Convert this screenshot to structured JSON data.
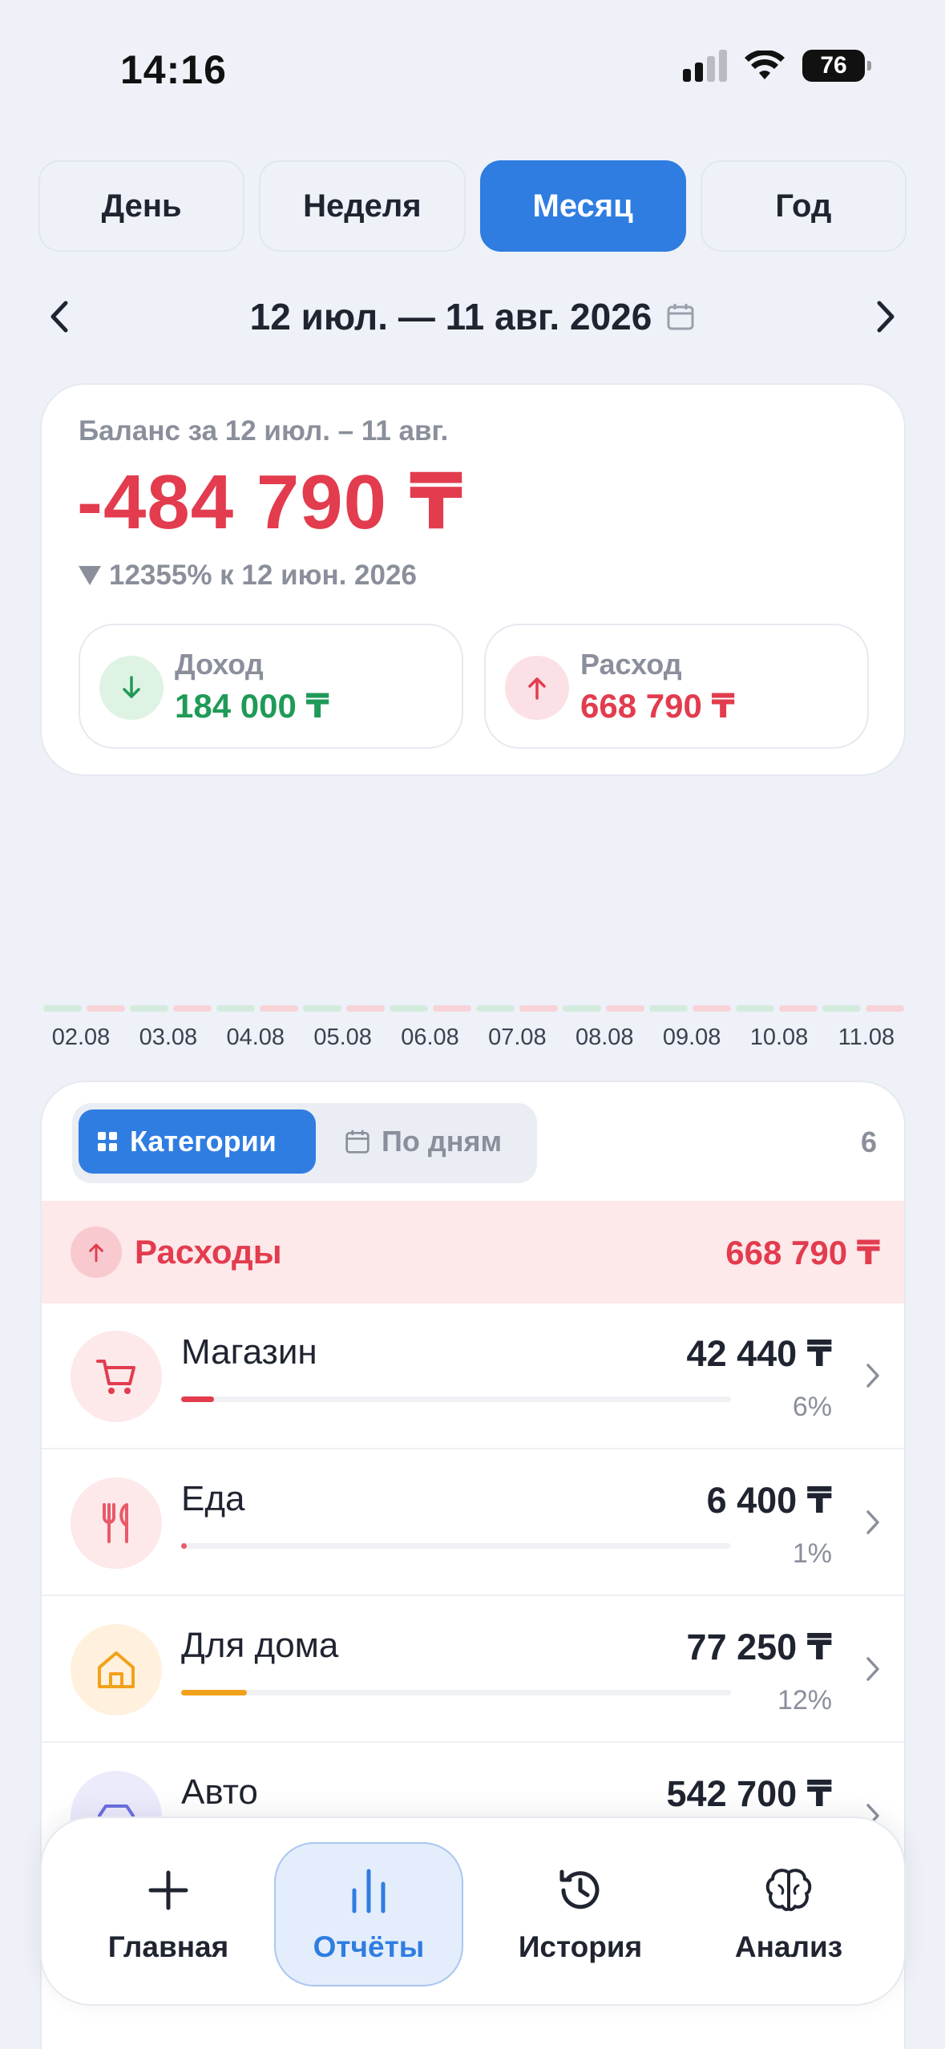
{
  "status_bar": {
    "time": "14:16",
    "battery": "76"
  },
  "period_tabs": [
    {
      "label": "День",
      "active": false
    },
    {
      "label": "Неделя",
      "active": false
    },
    {
      "label": "Месяц",
      "active": true
    },
    {
      "label": "Год",
      "active": false
    }
  ],
  "date_range": {
    "label": "12 июл. — 11 авг. 2026"
  },
  "balance": {
    "caption": "Баланс за 12 июл. – 11 авг.",
    "value": "-484 790 ₸",
    "delta": "12355% к 12 июн. 2026",
    "income": {
      "label": "Доход",
      "value": "184 000 ₸"
    },
    "expense": {
      "label": "Расход",
      "value": "668 790 ₸"
    }
  },
  "timeline": {
    "dates": [
      "02.08",
      "03.08",
      "04.08",
      "05.08",
      "06.08",
      "07.08",
      "08.08",
      "09.08",
      "10.08",
      "11.08"
    ],
    "colors": {
      "income": "#d3ebdd",
      "expense": "#f7d3d8"
    }
  },
  "view_toggle": {
    "categories_label": "Категории",
    "by_days_label": "По дням",
    "count": "6"
  },
  "expenses_section": {
    "title": "Расходы",
    "total": "668 790 ₸",
    "categories": [
      {
        "name": "Магазин",
        "amount": "42 440 ₸",
        "percent": "6%",
        "share": 0.06,
        "color": "#e23c4e",
        "bg": "#fde8ea",
        "icon": "shopping-cart-icon"
      },
      {
        "name": "Еда",
        "amount": "6 400 ₸",
        "percent": "1%",
        "share": 0.01,
        "color": "#e85a68",
        "bg": "#fde8ea",
        "icon": "fork-knife-icon"
      },
      {
        "name": "Для дома",
        "amount": "77 250 ₸",
        "percent": "12%",
        "share": 0.12,
        "color": "#f2a11a",
        "bg": "#fff1dd",
        "icon": "house-icon"
      },
      {
        "name": "Авто",
        "amount": "542 700 ₸",
        "percent": "",
        "share": 0.81,
        "color": "#6c6fe0",
        "bg": "#ecebfc",
        "icon": "car-icon"
      }
    ]
  },
  "bottom_nav": [
    {
      "label": "Главная",
      "icon": "plus-icon",
      "active": false
    },
    {
      "label": "Отчёты",
      "icon": "bar-chart-icon",
      "active": true
    },
    {
      "label": "История",
      "icon": "history-icon",
      "active": false
    },
    {
      "label": "Анализ",
      "icon": "brain-icon",
      "active": false
    }
  ]
}
